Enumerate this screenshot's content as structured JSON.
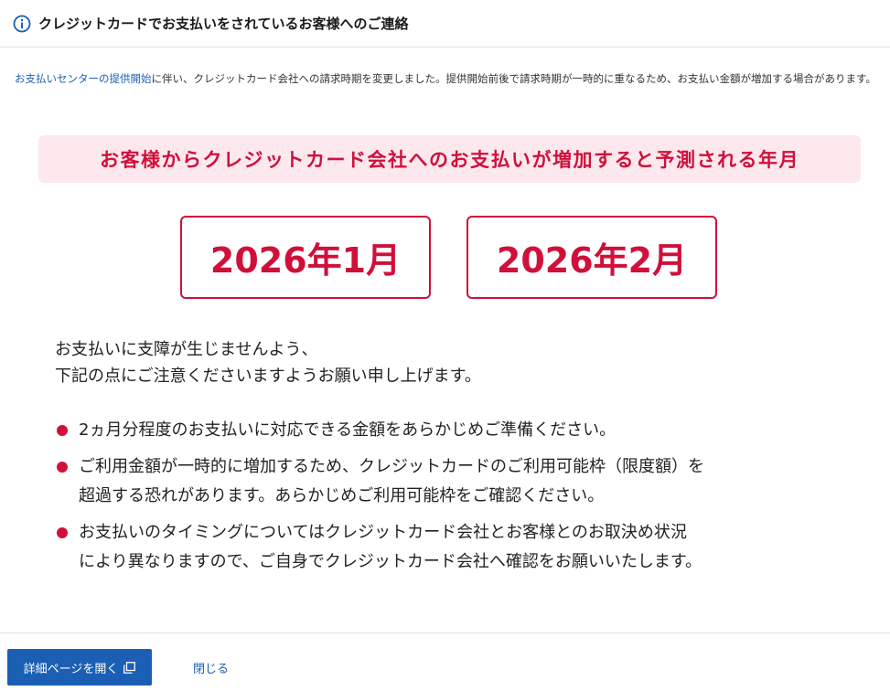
{
  "header": {
    "icon": "info-icon",
    "title": "クレジットカードでお支払いをされているお客様へのご連絡"
  },
  "intro": {
    "link_text": "お支払いセンターの提供開始",
    "text": "に伴い、クレジットカード会社への請求時期を変更しました。提供開始前後で請求時期が一時的に重なるため、お支払い金額が増加する場合があります。"
  },
  "banner": {
    "text": "お客様からクレジットカード会社へのお支払いが増加すると予測される年月"
  },
  "dates": [
    {
      "label": "2026年1月"
    },
    {
      "label": "2026年2月"
    }
  ],
  "notice": {
    "line1": "お支払いに支障が生じませんよう、",
    "line2": "下記の点にご注意くださいますようお願い申し上げます。"
  },
  "bullets": [
    {
      "lines": [
        "2ヵ月分程度のお支払いに対応できる金額をあらかじめご準備ください。"
      ]
    },
    {
      "lines": [
        "ご利用金額が一時的に増加するため、クレジットカードのご利用可能枠（限度額）を",
        "超過する恐れがあります。あらかじめご利用可能枠をご確認ください。"
      ]
    },
    {
      "lines": [
        "お支払いのタイミングについてはクレジットカード会社とお客様とのお取決め状況",
        "により異なりますので、ご自身でクレジットカード会社へ確認をお願いいたします。"
      ]
    }
  ],
  "footer": {
    "detail_button_label": "詳細ページを開く",
    "detail_button_icon": "external-link-icon",
    "close_label": "閉じる"
  },
  "colors": {
    "accent": "#d0103a",
    "banner_bg": "#fde8ee",
    "link": "#1a5fb4",
    "button_bg": "#1a5fb4"
  }
}
